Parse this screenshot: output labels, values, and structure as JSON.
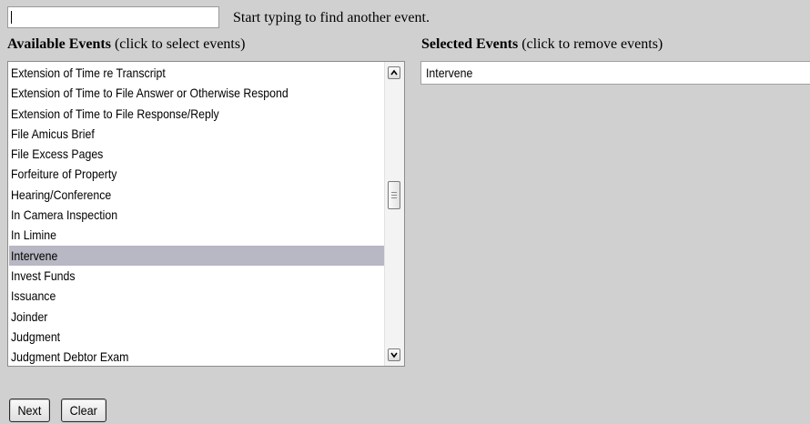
{
  "search": {
    "value": "",
    "hint": "Start typing to find another event."
  },
  "available": {
    "title": "Available Events",
    "note": "(click to select events)",
    "items": [
      "Extension of Time re Transcript",
      "Extension of Time to File Answer or Otherwise Respond",
      "Extension of Time to File Response/Reply",
      "File Amicus Brief",
      "File Excess Pages",
      "Forfeiture of Property",
      "Hearing/Conference",
      "In Camera Inspection",
      "In Limine",
      "Intervene",
      "Invest Funds",
      "Issuance",
      "Joinder",
      "Judgment",
      "Judgment Debtor Exam"
    ],
    "highlighted": "Intervene"
  },
  "selected": {
    "title": "Selected Events",
    "note": "(click to remove events)",
    "items": [
      "Intervene"
    ]
  },
  "buttons": {
    "next": "Next",
    "clear": "Clear"
  }
}
